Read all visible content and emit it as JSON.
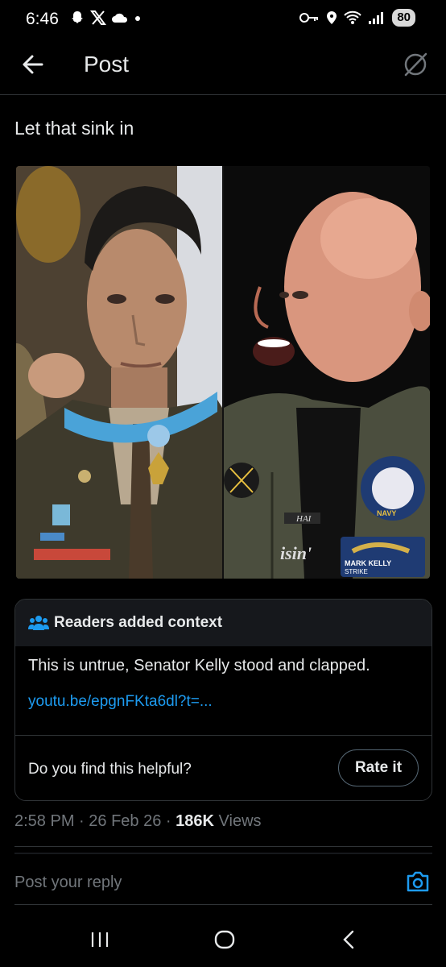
{
  "status_bar": {
    "time": "6:46",
    "battery": "80"
  },
  "header": {
    "title": "Post"
  },
  "post": {
    "text": "Let that sink in"
  },
  "media": {
    "right_patch_top": "HAI",
    "right_shirt_text": "isin'",
    "patch_navy": "NAVY",
    "patch_name": "MARK KELLY",
    "patch_strike": "STRIKE"
  },
  "community_note": {
    "heading": "Readers added context",
    "body": "This is untrue, Senator Kelly stood and clapped.",
    "link": "youtu.be/epgnFKta6dl?t=...",
    "question": "Do you find this helpful?",
    "rate_label": "Rate it"
  },
  "meta": {
    "time": "2:58 PM",
    "date": "26 Feb 26",
    "views_count": "186K",
    "views_label": "Views",
    "sep": "·"
  },
  "reply": {
    "placeholder": "Post your reply"
  },
  "colors": {
    "accent": "#1d9bf0",
    "background": "#000000",
    "muted": "#71767b",
    "border": "#2f3336"
  }
}
